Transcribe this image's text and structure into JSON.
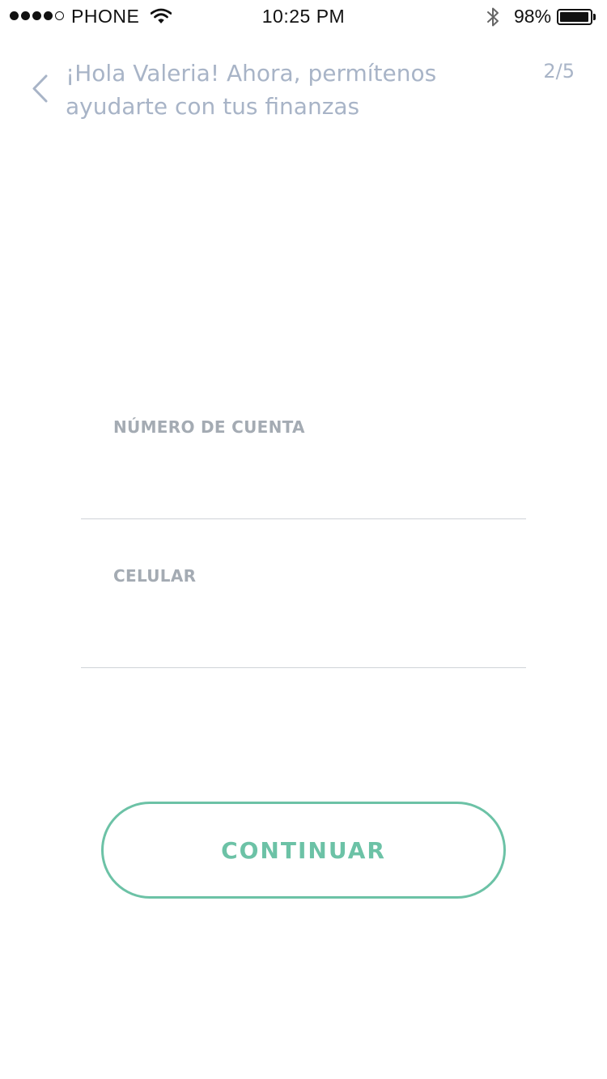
{
  "status_bar": {
    "signal_bars": 5,
    "signal_filled": 4,
    "carrier": "PHONE",
    "wifi_icon": "wifi-icon",
    "time": "10:25 PM",
    "bluetooth_icon": "bluetooth-icon",
    "battery_percent": "98%",
    "battery_level": 0.98
  },
  "header": {
    "back_icon": "chevron-left-icon",
    "title": "¡Hola Valeria! Ahora, permítenos ayudarte con tus finanzas",
    "step": "2/5"
  },
  "form": {
    "account_number": {
      "label": "NÚMERO DE CUENTA",
      "value": "",
      "placeholder": ""
    },
    "phone": {
      "label": "CELULAR",
      "value": "",
      "placeholder": ""
    }
  },
  "actions": {
    "continue_label": "CONTINUAR"
  },
  "colors": {
    "accent": "#6cc2a6",
    "title": "#a8b4c7",
    "label": "#a4abb3",
    "divider": "#cfd3d8"
  }
}
